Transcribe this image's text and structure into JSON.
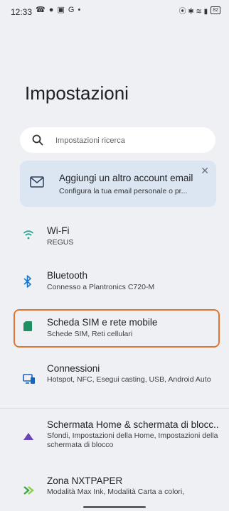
{
  "status": {
    "time": "12:33",
    "left_icons": "☎ ● ▣ G •",
    "right_icons": "⦿ ✱ ≋ ▮",
    "battery": "82"
  },
  "title": "Impostazioni",
  "search": {
    "placeholder": "Impostazioni ricerca"
  },
  "email_card": {
    "title": "Aggiungi un altro account email",
    "subtitle": "Configura la tua email personale o pr..."
  },
  "items": [
    {
      "title": "Wi-Fi",
      "subtitle": "REGUS",
      "icon": "wifi-icon",
      "color": "#1aa38a"
    },
    {
      "title": "Bluetooth",
      "subtitle": "Connesso a Plantronics C720-M",
      "icon": "bluetooth-icon",
      "color": "#1976d2"
    },
    {
      "title": "Scheda SIM e rete mobile",
      "subtitle": "Schede SIM, Reti cellulari",
      "icon": "sim-icon",
      "color": "#1f8f63"
    },
    {
      "title": "Connessioni",
      "subtitle": "Hotspot, NFC, Esegui casting, USB, Android Auto",
      "icon": "connections-icon",
      "color": "#1565c0"
    },
    {
      "title": "Schermata Home & schermata di blocc..",
      "subtitle": "Sfondi, Impostazioni della Home, Impostazioni della schermata di blocco",
      "icon": "home-screen-icon",
      "color": "#6a45b8"
    },
    {
      "title": "Zona NXTPAPER",
      "subtitle": "Modalità Max Ink, Modalità Carta a colori,",
      "icon": "nxtpaper-icon",
      "color": "#3aa64a"
    }
  ]
}
